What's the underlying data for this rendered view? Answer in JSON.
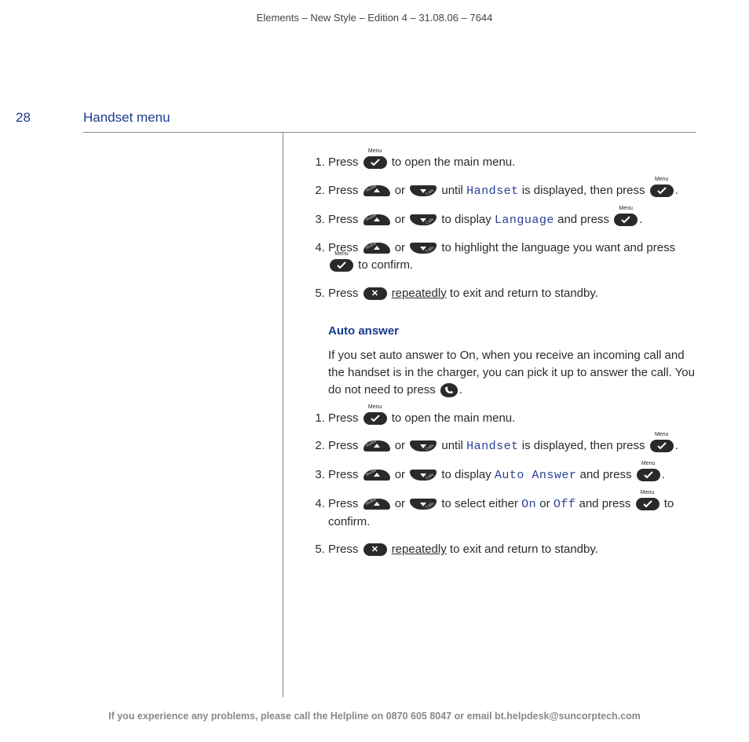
{
  "meta": {
    "top": "Elements – New Style – Edition 4 – 31.08.06 – 7644"
  },
  "page": {
    "num": "28",
    "title": "Handset menu"
  },
  "labels": {
    "menu": "Menu",
    "redial": "Redial",
    "calls": "Calls",
    "press": "Press",
    "or": "or",
    "until": "until",
    "displayed_then": "is displayed, then press",
    "to_display": "to display",
    "and_press": "and press",
    "dot": ".",
    "open_main": "to open the main menu.",
    "highlight_lang": "to highlight the language you want and press",
    "to_confirm": "to confirm.",
    "select_either": "to select either",
    "repeatedly": "repeatedly",
    "exit_standby": "to exit and return to standby."
  },
  "lcd": {
    "handset": "Handset",
    "language": "Language",
    "auto_answer": "Auto Answer",
    "on": "On",
    "off": "Off"
  },
  "subhead": "Auto answer",
  "intro": {
    "p1": "If you set auto answer to On, when you receive an incoming call and the handset is in the charger, you can pick it up to answer the call. You do not need to press",
    "p2": "."
  },
  "footer": "If you experience any problems, please call the Helpline on 0870 605 8047 or email bt.helpdesk@suncorptech.com"
}
